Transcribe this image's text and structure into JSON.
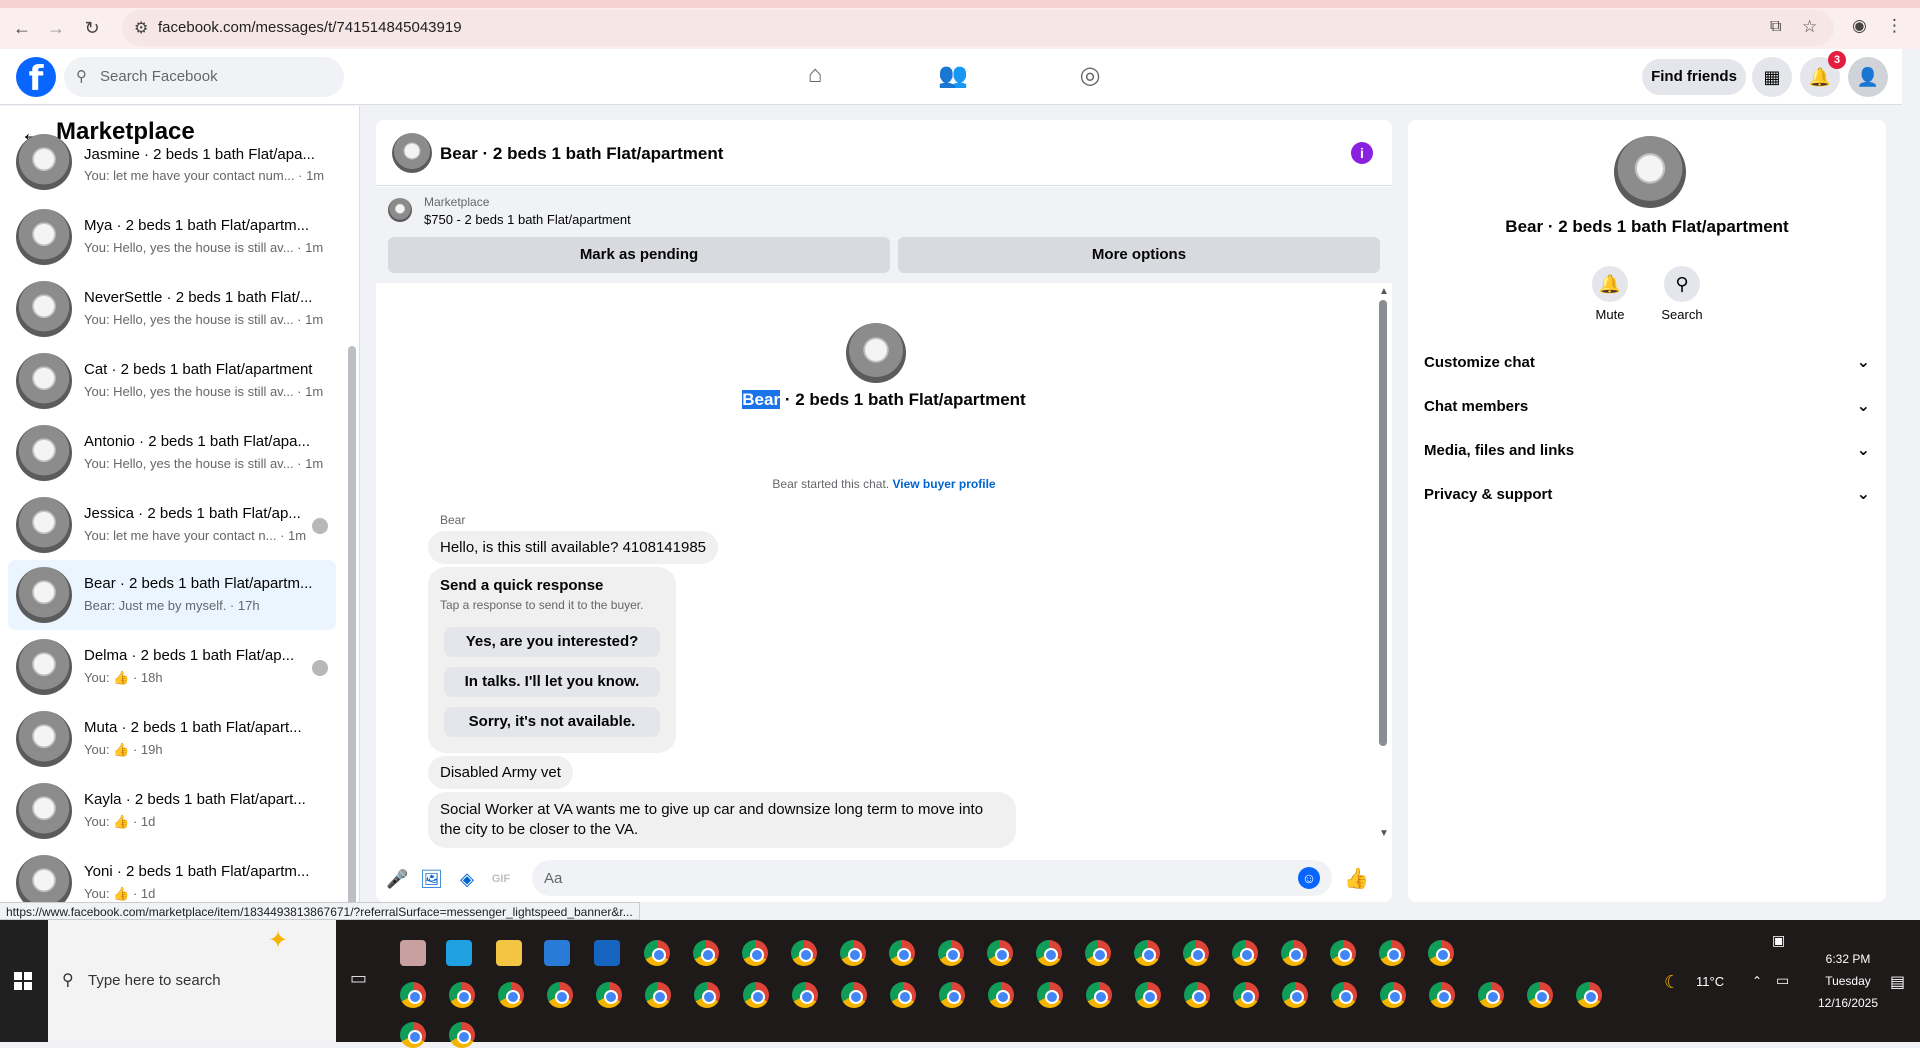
{
  "browser": {
    "url": "facebook.com/messages/t/741514845043919"
  },
  "fb": {
    "search_placeholder": "Search Facebook",
    "find_friends": "Find friends",
    "notification_count": "3"
  },
  "sidebar": {
    "title": "Marketplace",
    "conversations": [
      {
        "name": "Jasmine · 2 beds 1 bath Flat/apa...",
        "preview": "You: let me have your contact num... · 1m"
      },
      {
        "name": "Mya · 2 beds 1 bath Flat/apartm...",
        "preview": "You: Hello, yes the house is still av... · 1m"
      },
      {
        "name": "NeverSettle · 2 beds 1 bath Flat/...",
        "preview": "You: Hello, yes the house is still av... · 1m"
      },
      {
        "name": "Cat · 2 beds 1 bath Flat/apartment",
        "preview": "You: Hello, yes the house is still av... · 1m"
      },
      {
        "name": "Antonio · 2 beds 1 bath Flat/apa...",
        "preview": "You: Hello, yes the house is still av... · 1m"
      },
      {
        "name": "Jessica · 2 beds 1 bath Flat/ap...",
        "preview": "You: let me have your contact n... · 1m"
      },
      {
        "name": "Bear · 2 beds 1 bath Flat/apartm...",
        "preview": "Bear: Just me by myself. · 17h"
      },
      {
        "name": "Delma · 2 beds 1 bath Flat/ap...",
        "preview": "You: 👍 · 18h"
      },
      {
        "name": "Muta · 2 beds 1 bath Flat/apart...",
        "preview": "You: 👍 · 19h"
      },
      {
        "name": "Kayla · 2 beds 1 bath Flat/apart...",
        "preview": "You: 👍 · 1d"
      },
      {
        "name": "Yoni · 2 beds 1 bath Flat/apartm...",
        "preview": "You: 👍 · 1d"
      }
    ]
  },
  "chat": {
    "header_name": "Bear · 2 beds 1 bath Flat/apartment",
    "marketplace_label": "Marketplace",
    "listing": "$750 - 2 beds 1 bath Flat/apartment",
    "mark_pending": "Mark as pending",
    "more_options": "More options",
    "center_highlight": "Bear",
    "center_rest": " · 2 beds 1 bath Flat/apartment",
    "started_text": "Bear started this chat. ",
    "view_profile": "View buyer profile",
    "sender": "Bear",
    "msg1": "Hello, is this still available? 4108141985",
    "quick_title": "Send a quick response",
    "quick_sub": "Tap a response to send it to the buyer.",
    "quick_1": "Yes, are you interested?",
    "quick_2": "In talks. I'll let you know.",
    "quick_3": "Sorry, it's not available.",
    "msg2": "Disabled Army vet",
    "msg3": "Social Worker at VA wants me to give up car and downsize long term to move into the city to be closer to the VA.",
    "composer_placeholder": "Aa"
  },
  "right_panel": {
    "name": "Bear · 2 beds 1 bath Flat/apartment",
    "mute": "Mute",
    "search": "Search",
    "items": [
      "Customize chat",
      "Chat members",
      "Media, files and links",
      "Privacy & support"
    ]
  },
  "status_link": "https://www.facebook.com/marketplace/item/1834493813867671/?referralSurface=messenger_lightspeed_banner&r...",
  "taskbar": {
    "search_placeholder": "Type here to search",
    "temperature": "11°C",
    "time": "6:32 PM",
    "day": "Tuesday",
    "date": "12/16/2025"
  },
  "colors": {
    "fb_blue": "#0866ff",
    "active_conv": "#ebf5ff",
    "info_purple": "#8a20e0"
  }
}
